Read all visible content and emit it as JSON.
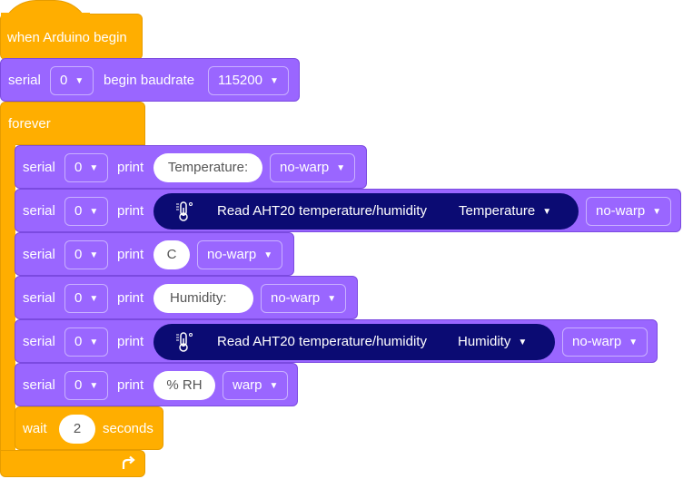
{
  "hat": {
    "label": "when Arduino begin"
  },
  "begin_block": {
    "serial_label": "serial",
    "port": "0",
    "text": "begin baudrate",
    "baud": "115200"
  },
  "forever": {
    "label": "forever"
  },
  "rows": [
    {
      "serial": "serial",
      "port": "0",
      "print": "print",
      "value": "Temperature:",
      "mode": "no-warp"
    },
    {
      "serial": "serial",
      "port": "0",
      "print": "print",
      "sensor": "Read AHT20 temperature/humidity",
      "field": "Temperature",
      "mode": "no-warp"
    },
    {
      "serial": "serial",
      "port": "0",
      "print": "print",
      "value": "C",
      "mode": "no-warp"
    },
    {
      "serial": "serial",
      "port": "0",
      "print": "print",
      "value": "Humidity:",
      "mode": "no-warp"
    },
    {
      "serial": "serial",
      "port": "0",
      "print": "print",
      "sensor": "Read AHT20 temperature/humidity",
      "field": "Humidity",
      "mode": "no-warp"
    },
    {
      "serial": "serial",
      "port": "0",
      "print": "print",
      "value": "% RH",
      "mode": "warp"
    }
  ],
  "wait": {
    "label": "wait",
    "value": "2",
    "unit": "seconds"
  },
  "icons": {
    "dropdown": "caret-down-icon",
    "sensor": "thermometer-icon",
    "loop": "loop-arrow-icon"
  },
  "colors": {
    "events": "#ffae00",
    "serial": "#9a66ff",
    "sensor": "#0b0b73"
  }
}
